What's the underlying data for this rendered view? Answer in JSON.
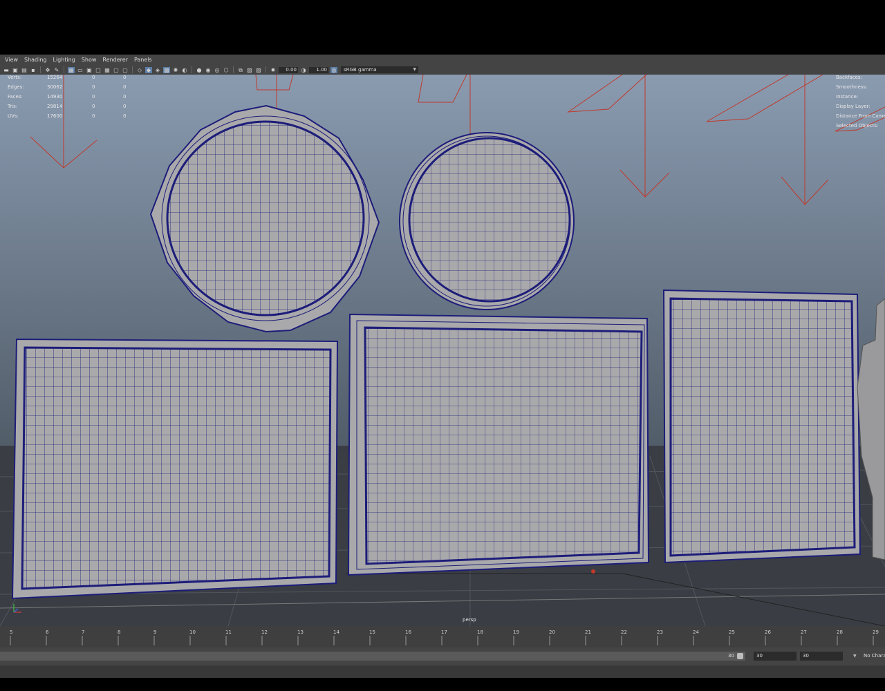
{
  "menu": [
    "View",
    "Shading",
    "Lighting",
    "Show",
    "Renderer",
    "Panels"
  ],
  "toolbar": {
    "exposure_value": "0.00",
    "gamma_value": "1.00",
    "color_space": "sRGB gamma",
    "icons": [
      "select-camera-icon",
      "camera-attributes-icon",
      "bookmarks-icon",
      "image-plane-icon",
      "2d-pan-zoom-icon",
      "grease-pencil-icon",
      "grid-icon",
      "film-gate-icon",
      "resolution-gate-icon",
      "gate-mask-icon",
      "field-chart-icon",
      "safe-action-icon",
      "safe-title-icon",
      "wireframe-icon",
      "smooth-shade-icon",
      "default-material-icon",
      "textured-icon",
      "use-all-lights-icon",
      "shadows-icon",
      "screen-space-ao-icon",
      "motion-blur-icon",
      "multisample-aa-icon",
      "depth-of-field-icon",
      "isolate-select-icon",
      "xray-icon",
      "xray-joints-icon",
      "backface-culling-icon",
      "exposure-icon",
      "gamma-icon",
      "color-management-icon"
    ]
  },
  "hud_left": {
    "rows": [
      {
        "label": "Verts:",
        "v1": "15264",
        "v2": "0",
        "v3": "0"
      },
      {
        "label": "Edges:",
        "v1": "30062",
        "v2": "0",
        "v3": "0"
      },
      {
        "label": "Faces:",
        "v1": "14930",
        "v2": "0",
        "v3": "0"
      },
      {
        "label": "Tris:",
        "v1": "29814",
        "v2": "0",
        "v3": "0"
      },
      {
        "label": "UVs:",
        "v1": "17600",
        "v2": "0",
        "v3": "0"
      }
    ]
  },
  "hud_right": [
    "Backfaces:",
    "Smoothness:",
    "Instance:",
    "Display Layer:",
    "Distance From Camera:",
    "Selected Objects:"
  ],
  "camera_label": "persp",
  "timeline": {
    "ticks": [
      "5",
      "6",
      "7",
      "8",
      "9",
      "10",
      "11",
      "12",
      "13",
      "14",
      "15",
      "16",
      "17",
      "18",
      "19",
      "20",
      "21",
      "22",
      "23",
      "24",
      "25",
      "26",
      "27",
      "28",
      "29"
    ]
  },
  "range": {
    "end_label": "30",
    "field_a": "30",
    "field_b": "30",
    "character_set": "No Character Set"
  },
  "colors": {
    "mesh_fill": "#a9a9ab",
    "wire": "#1d1d7a",
    "light_lines": "#c0392b",
    "bg_top": "#8a9bb0",
    "bg_bottom": "#4f5a66"
  }
}
